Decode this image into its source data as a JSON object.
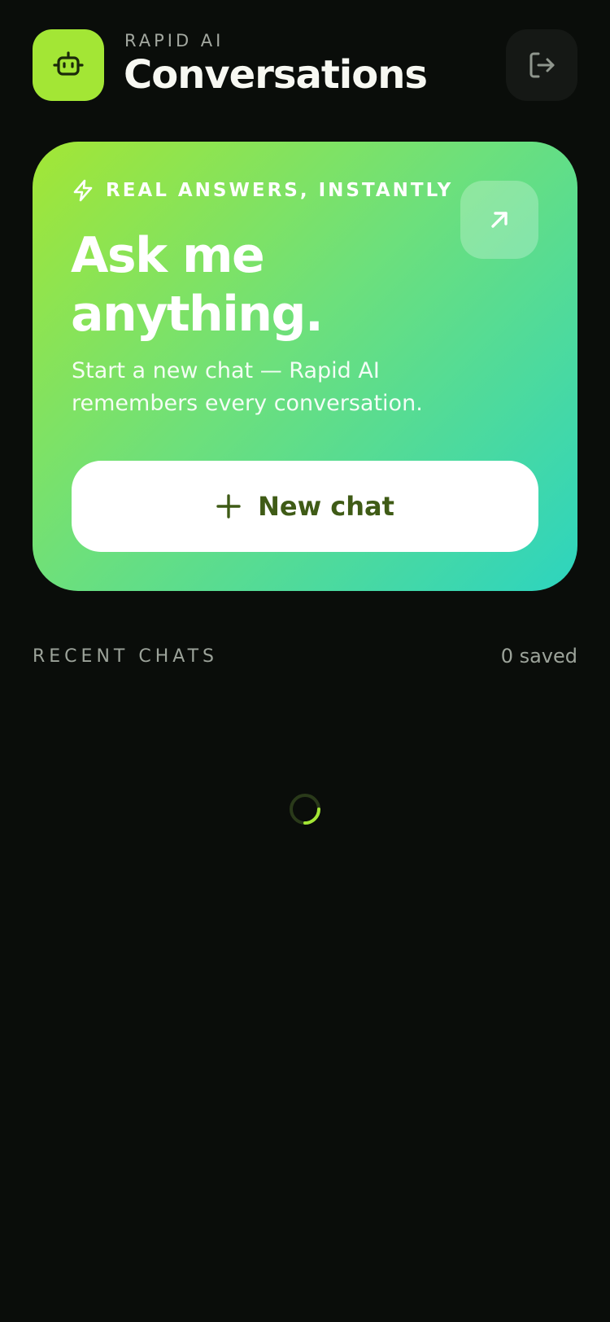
{
  "header": {
    "brand": "RAPID AI",
    "title": "Conversations",
    "logo_icon": "robot-icon",
    "logout_icon": "logout-icon"
  },
  "hero": {
    "tagline": "REAL ANSWERS, INSTANTLY",
    "tagline_icon": "lightning-icon",
    "heading": "Ask me anything.",
    "subtext": "Start a new chat — Rapid AI remembers every conversation.",
    "expand_icon": "arrow-up-right-icon",
    "new_chat_label": "New chat",
    "new_chat_icon": "plus-icon"
  },
  "recent": {
    "title": "RECENT CHATS",
    "saved_count": "0 saved",
    "loading": true
  },
  "colors": {
    "background": "#0a0d0a",
    "accent": "#a3e635",
    "gradient_end": "#2dd4bf",
    "button_text": "#3f5b16"
  }
}
